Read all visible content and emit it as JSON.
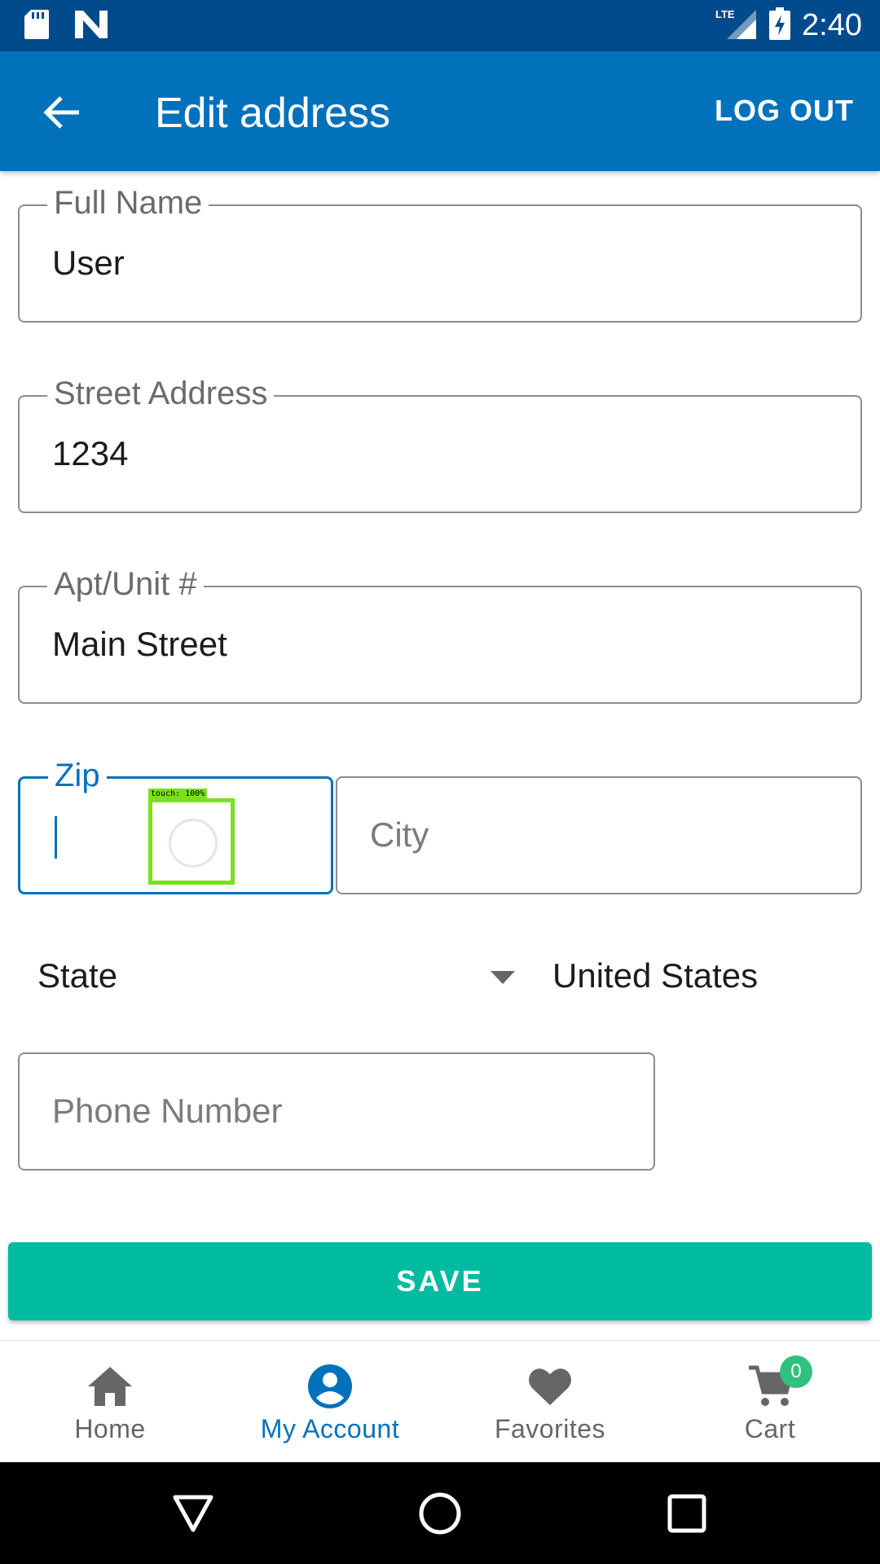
{
  "status_bar": {
    "time": "2:40",
    "network": "LTE"
  },
  "app_bar": {
    "title": "Edit address",
    "logout_label": "LOG OUT"
  },
  "form": {
    "full_name": {
      "label": "Full Name",
      "value": "User"
    },
    "street_address": {
      "label": "Street Address",
      "value": "1234"
    },
    "apt_unit": {
      "label": "Apt/Unit #",
      "value": "Main Street"
    },
    "zip": {
      "label": "Zip",
      "value": ""
    },
    "city": {
      "placeholder": "City"
    },
    "state": {
      "value": "State"
    },
    "country": {
      "value": "United States"
    },
    "phone": {
      "placeholder": "Phone Number"
    }
  },
  "touch_overlay": {
    "label": "touch: 100%"
  },
  "save_label": "SAVE",
  "bottom_nav": {
    "items": [
      {
        "label": "Home",
        "icon": "home-icon",
        "active": false
      },
      {
        "label": "My Account",
        "icon": "account-icon",
        "active": true
      },
      {
        "label": "Favorites",
        "icon": "heart-icon",
        "active": false
      },
      {
        "label": "Cart",
        "icon": "cart-icon",
        "active": false,
        "badge": "0"
      }
    ]
  },
  "colors": {
    "primary": "#0271bc",
    "status_bar": "#014a8b",
    "save": "#00bba0",
    "badge": "#2ec27e"
  }
}
